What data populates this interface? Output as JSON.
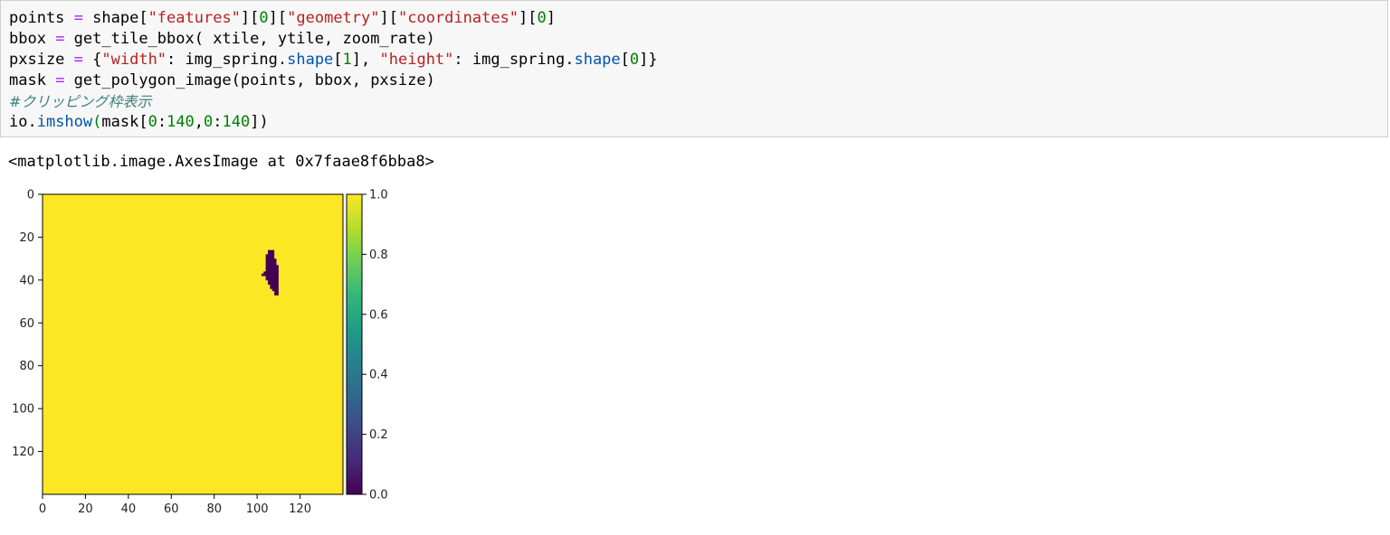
{
  "code_cell": {
    "lines": [
      [
        {
          "t": "points ",
          "c": ""
        },
        {
          "t": "=",
          "c": "kw-op"
        },
        {
          "t": " shape[",
          "c": ""
        },
        {
          "t": "\"features\"",
          "c": "str"
        },
        {
          "t": "][",
          "c": ""
        },
        {
          "t": "0",
          "c": "num"
        },
        {
          "t": "][",
          "c": ""
        },
        {
          "t": "\"geometry\"",
          "c": "str"
        },
        {
          "t": "][",
          "c": ""
        },
        {
          "t": "\"coordinates\"",
          "c": "str"
        },
        {
          "t": "][",
          "c": ""
        },
        {
          "t": "0",
          "c": "num"
        },
        {
          "t": "]",
          "c": ""
        }
      ],
      [
        {
          "t": "bbox ",
          "c": ""
        },
        {
          "t": "=",
          "c": "kw-op"
        },
        {
          "t": " get_tile_bbox( xtile, ytile, zoom_rate)",
          "c": ""
        }
      ],
      [
        {
          "t": "pxsize ",
          "c": ""
        },
        {
          "t": "=",
          "c": "kw-op"
        },
        {
          "t": " {",
          "c": ""
        },
        {
          "t": "\"width\"",
          "c": "str"
        },
        {
          "t": ": img_spring.",
          "c": ""
        },
        {
          "t": "shape",
          "c": "attr"
        },
        {
          "t": "[",
          "c": ""
        },
        {
          "t": "1",
          "c": "num"
        },
        {
          "t": "], ",
          "c": ""
        },
        {
          "t": "\"height\"",
          "c": "str"
        },
        {
          "t": ": img_spring.",
          "c": ""
        },
        {
          "t": "shape",
          "c": "attr"
        },
        {
          "t": "[",
          "c": ""
        },
        {
          "t": "0",
          "c": "num"
        },
        {
          "t": "]}",
          "c": ""
        }
      ],
      [
        {
          "t": "mask ",
          "c": ""
        },
        {
          "t": "=",
          "c": "kw-op"
        },
        {
          "t": " get_polygon_image(points, bbox, pxsize)",
          "c": ""
        }
      ],
      [
        {
          "t": "#クリッピング枠表示",
          "c": "cmt"
        }
      ],
      [
        {
          "t": "io.",
          "c": ""
        },
        {
          "t": "imshow",
          "c": "attr"
        },
        {
          "t": "(",
          "c": "paren"
        },
        {
          "t": "mask[",
          "c": ""
        },
        {
          "t": "0",
          "c": "num"
        },
        {
          "t": ":",
          "c": ""
        },
        {
          "t": "140",
          "c": "num"
        },
        {
          "t": ",",
          "c": ""
        },
        {
          "t": "0",
          "c": "num"
        },
        {
          "t": ":",
          "c": ""
        },
        {
          "t": "140",
          "c": "num"
        },
        {
          "t": "])",
          "c": ""
        }
      ]
    ]
  },
  "output": {
    "text": "<matplotlib.image.AxesImage at 0x7faae8f6bba8>"
  },
  "chart_data": {
    "type": "heatmap",
    "title": "",
    "xlabel": "",
    "ylabel": "",
    "x_ticks": [
      0,
      20,
      40,
      60,
      80,
      100,
      120
    ],
    "y_ticks": [
      0,
      20,
      40,
      60,
      80,
      100,
      120
    ],
    "xlim": [
      0,
      140
    ],
    "ylim": [
      140,
      0
    ],
    "background_value": 1.0,
    "background_color": "#fde725",
    "low_color": "#440154",
    "region_value_0_rows": [
      {
        "y": 26,
        "x0": 105,
        "x1": 107
      },
      {
        "y": 27,
        "x0": 105,
        "x1": 107
      },
      {
        "y": 28,
        "x0": 104,
        "x1": 107
      },
      {
        "y": 29,
        "x0": 104,
        "x1": 107
      },
      {
        "y": 30,
        "x0": 104,
        "x1": 108
      },
      {
        "y": 31,
        "x0": 104,
        "x1": 108
      },
      {
        "y": 32,
        "x0": 104,
        "x1": 108
      },
      {
        "y": 33,
        "x0": 104,
        "x1": 109
      },
      {
        "y": 34,
        "x0": 104,
        "x1": 109
      },
      {
        "y": 35,
        "x0": 104,
        "x1": 109
      },
      {
        "y": 36,
        "x0": 103,
        "x1": 109
      },
      {
        "y": 37,
        "x0": 102,
        "x1": 109
      },
      {
        "y": 38,
        "x0": 104,
        "x1": 109
      },
      {
        "y": 39,
        "x0": 104,
        "x1": 109
      },
      {
        "y": 40,
        "x0": 105,
        "x1": 109
      },
      {
        "y": 41,
        "x0": 105,
        "x1": 109
      },
      {
        "y": 42,
        "x0": 106,
        "x1": 109
      },
      {
        "y": 43,
        "x0": 106,
        "x1": 109
      },
      {
        "y": 44,
        "x0": 107,
        "x1": 109
      },
      {
        "y": 45,
        "x0": 108,
        "x1": 109
      },
      {
        "y": 46,
        "x0": 108,
        "x1": 109
      }
    ],
    "colorbar": {
      "vmin": 0.0,
      "vmax": 1.0,
      "ticks": [
        "0.0",
        "0.2",
        "0.4",
        "0.6",
        "0.8",
        "1.0"
      ],
      "colormap": "viridis",
      "stops": [
        "#440154",
        "#482878",
        "#3e4989",
        "#31688e",
        "#26828e",
        "#1f9e89",
        "#35b779",
        "#6ece58",
        "#b5de2b",
        "#fde725"
      ]
    }
  }
}
